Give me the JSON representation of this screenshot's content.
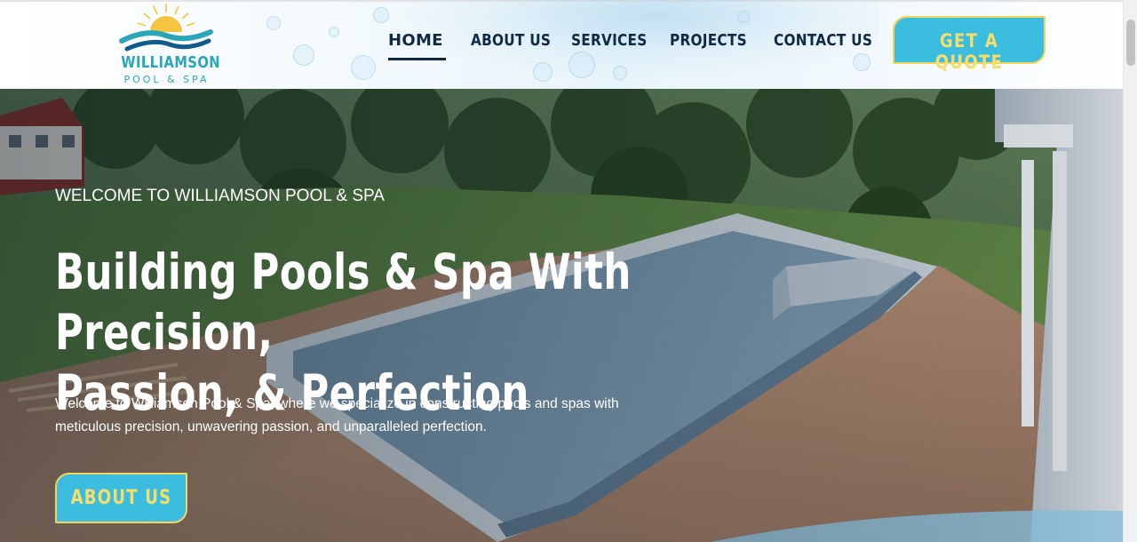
{
  "header": {
    "logo": {
      "name": "WILLIAMSON",
      "tagline": "POOL & SPA",
      "icon": "sun-wave-logo-icon"
    },
    "nav": [
      {
        "label": "HOME",
        "active": true
      },
      {
        "label": "ABOUT US",
        "active": false
      },
      {
        "label": "SERVICES",
        "active": false
      },
      {
        "label": "PROJECTS",
        "active": false
      },
      {
        "label": "CONTACT US",
        "active": false
      }
    ],
    "cta_label": "GET A QUOTE"
  },
  "hero": {
    "eyebrow": "WELCOME TO WILLIAMSON POOL & SPA",
    "title_line1": "Building Pools & Spa With Precision,",
    "title_line2": "Passion, & Perfection",
    "description": "Welcome to Williamson Pool & Spa, where we specialize in constructing pools and spas with meticulous precision, unwavering passion, and unparalleled perfection.",
    "button_label": "ABOUT US",
    "background": "pool-construction-photo"
  },
  "colors": {
    "brand_teal": "#2aa6b9",
    "button_blue": "#3bbde0",
    "button_yellow": "#f6de6b",
    "nav_navy": "#0f2a44"
  }
}
